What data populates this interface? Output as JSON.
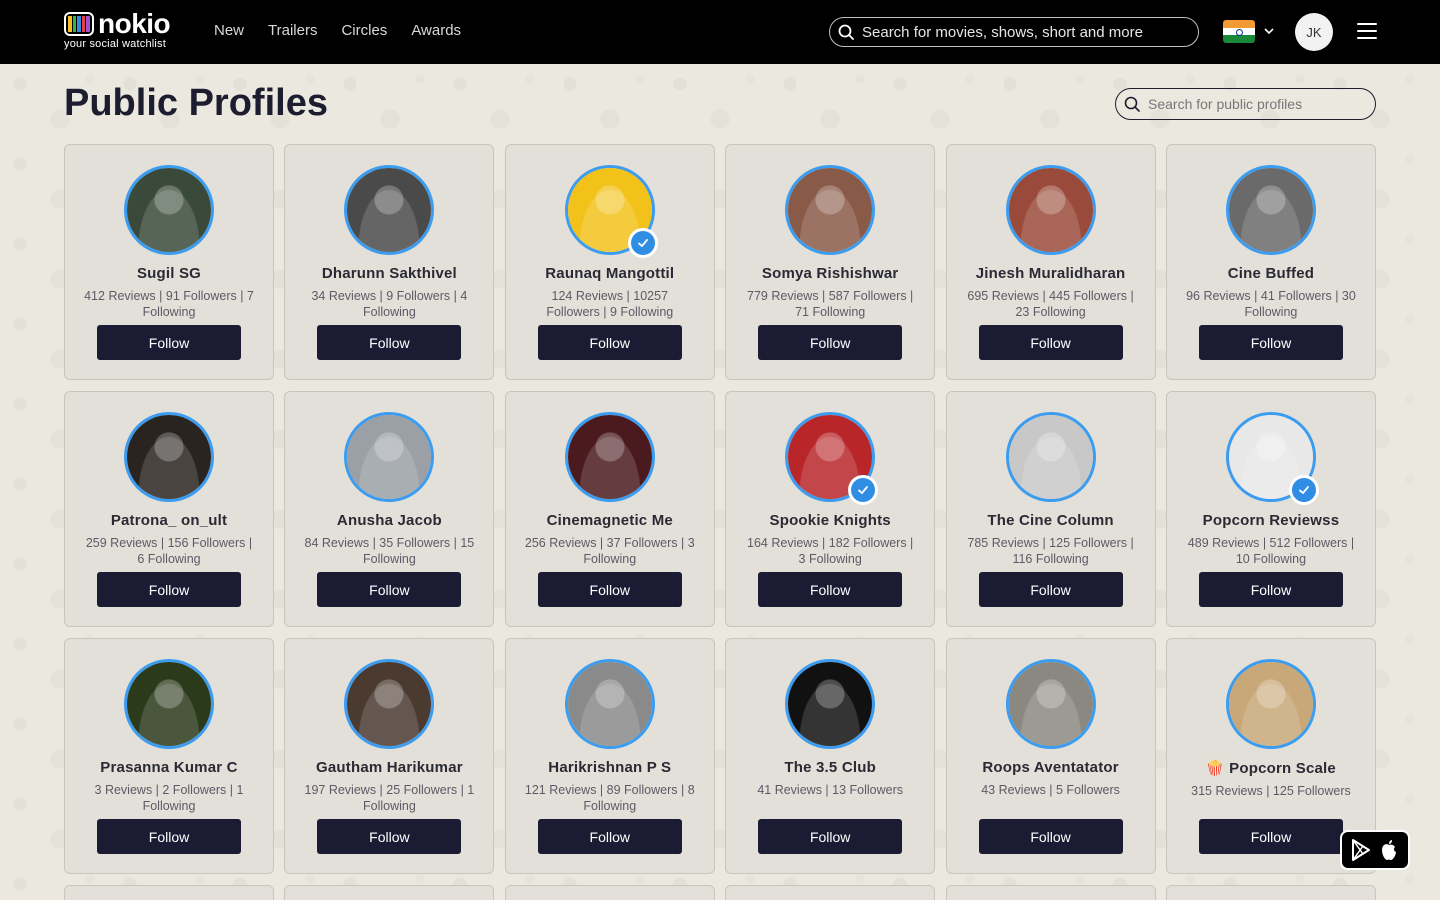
{
  "header": {
    "logo_word": "nokio",
    "logo_tagline": "your social watchlist",
    "nav": [
      "New",
      "Trailers",
      "Circles",
      "Awards"
    ],
    "search_placeholder": "Search for movies, shows, short and more",
    "user_initials": "JK"
  },
  "main": {
    "title": "Public Profiles",
    "search_placeholder": "Search for public profiles",
    "follow_label": "Follow"
  },
  "profiles": [
    {
      "name": "Sugil SG",
      "stats": "412 Reviews | 91 Followers | 7 Following",
      "verified": false,
      "color": "#3a4a3a"
    },
    {
      "name": "Dharunn Sakthivel",
      "stats": "34 Reviews | 9 Followers | 4 Following",
      "verified": false,
      "color": "#4a4a4a"
    },
    {
      "name": "Raunaq Mangottil",
      "stats": "124 Reviews | 10257 Followers | 9 Following",
      "verified": true,
      "color": "#f2c21a"
    },
    {
      "name": "Somya Rishishwar",
      "stats": "779 Reviews | 587 Followers | 71 Following",
      "verified": false,
      "color": "#8a5a48"
    },
    {
      "name": "Jinesh Muralidharan",
      "stats": "695 Reviews | 445 Followers | 23 Following",
      "verified": false,
      "color": "#9a4a3a"
    },
    {
      "name": "Cine Buffed",
      "stats": "96 Reviews | 41 Followers | 30 Following",
      "verified": false,
      "color": "#6a6a6a"
    },
    {
      "name": "Patrona_ on_ult",
      "stats": "259 Reviews | 156 Followers | 6 Following",
      "verified": false,
      "color": "#2a2420"
    },
    {
      "name": "Anusha Jacob",
      "stats": "84 Reviews | 35 Followers | 15 Following",
      "verified": false,
      "color": "#9aa0a6"
    },
    {
      "name": "Cinemagnetic Me",
      "stats": "256 Reviews | 37 Followers | 3 Following",
      "verified": false,
      "color": "#4a1a1e"
    },
    {
      "name": "Spookie Knights",
      "stats": "164 Reviews | 182 Followers | 3 Following",
      "verified": true,
      "color": "#b8262a"
    },
    {
      "name": "The Cine Column",
      "stats": "785 Reviews | 125 Followers | 116 Following",
      "verified": false,
      "color": "#c8c8c8"
    },
    {
      "name": "Popcorn Reviewss",
      "stats": "489 Reviews | 512 Followers | 10 Following",
      "verified": true,
      "color": "#e8e8e8"
    },
    {
      "name": "Prasanna Kumar C",
      "stats": "3 Reviews | 2 Followers | 1 Following",
      "verified": false,
      "color": "#2a3a1a"
    },
    {
      "name": "Gautham Harikumar",
      "stats": "197 Reviews | 25 Followers | 1 Following",
      "verified": false,
      "color": "#4a3a30"
    },
    {
      "name": "Harikrishnan P S",
      "stats": "121 Reviews | 89 Followers | 8 Following",
      "verified": false,
      "color": "#8a8a8a"
    },
    {
      "name": "The 3.5 Club",
      "stats": "41 Reviews | 13 Followers",
      "verified": false,
      "color": "#111111"
    },
    {
      "name": "Roops Aventatator",
      "stats": "43 Reviews | 5 Followers",
      "verified": false,
      "color": "#8a8880"
    },
    {
      "name": "🍿 Popcorn Scale",
      "stats": "315 Reviews | 125 Followers",
      "verified": false,
      "color": "#c8a878"
    }
  ],
  "icons": {
    "top_search": "search-icon",
    "profile_search": "search-icon",
    "flag": "india-flag-icon",
    "menu": "hamburger-menu-icon",
    "verified": "verified-check-icon",
    "store": "app-store-icons"
  },
  "colors": {
    "navbar": "#000000",
    "button": "#1b1c33",
    "avatar_ring": "#3b9cf0",
    "verified": "#2f8de4"
  }
}
